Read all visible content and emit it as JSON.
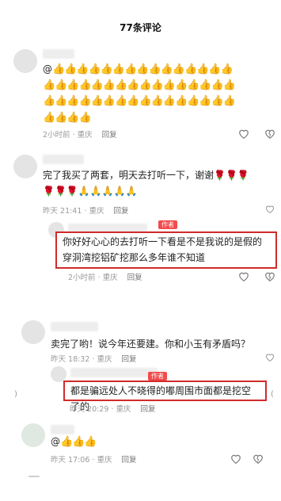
{
  "header": {
    "title": "77条评论"
  },
  "comments": [
    {
      "text_prefix": "@",
      "emoji_rows": [
        "👍👍👍👍👍👍👍👍👍👍👍👍👍👍👍",
        "👍👍👍👍👍👍👍👍👍👍👍👍👍👍👍👍",
        "👍👍👍👍👍👍👍👍👍👍👍👍👍👍👍👍",
        "👍👍👍👍"
      ],
      "time": "2小时前 · 重庆",
      "reply": "回复"
    },
    {
      "text": "完了我买了两套，明天去打听一下，谢谢🌹🌹🌹",
      "text2": "🌹🌹🌹🙏🙏🙏🙏🙏",
      "time": "昨天 21:41 · 重庆",
      "reply": "回复",
      "sub": {
        "badge": "作者",
        "text": "你好好心心的去打听一下看是不是我说的是假的穿洞湾挖铝矿挖那么多年谁不知道",
        "time": "2小时前 · 重庆",
        "reply": "回复"
      }
    },
    {
      "text": "卖完了哟！说今年还要建。你和小玉有矛盾吗？",
      "time": "昨天 18:32 · 重庆",
      "reply": "回复",
      "sub": {
        "badge": "作者",
        "text": "都是骗远处人不晓得的嘟周围市面都是挖空了的",
        "time": "昨天 20:29 · 重庆",
        "reply": "回复"
      }
    },
    {
      "text_prefix": "@",
      "emoji": "👍👍👍",
      "time": "昨天 17:06 · 重庆",
      "reply": "回复"
    }
  ]
}
